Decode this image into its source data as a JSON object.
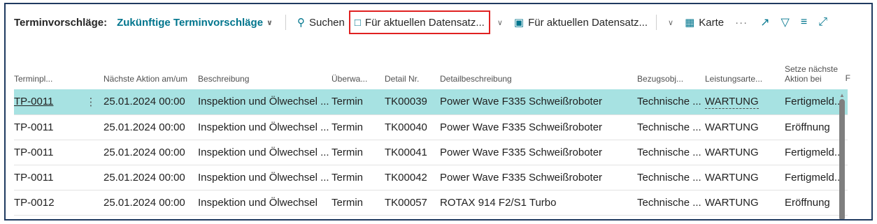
{
  "toolbar": {
    "title": "Terminvorschläge:",
    "view_name": "Zukünftige Terminvorschläge",
    "search_label": "Suchen",
    "action1_label": "Für aktuellen Datensatz...",
    "action2_label": "Für aktuellen Datensatz...",
    "map_label": "Karte",
    "more": "···"
  },
  "table": {
    "headers": [
      "Terminpl...",
      "",
      "Nächste Aktion am/um",
      "Beschreibung",
      "Überwa...",
      "Detail Nr.",
      "Detailbeschreibung",
      "Bezugsobj...",
      "Leistungsarte...",
      "Setze nächste Aktion bei"
    ],
    "clipped_header": "F",
    "rows": [
      [
        "TP-0011",
        "⋮",
        "25.01.2024 00:00",
        "Inspektion und Ölwechsel ...",
        "Termin",
        "TK00039",
        "Power Wave F335 Schweißroboter",
        "Technische ...",
        "WARTUNG",
        "Fertigmeld..."
      ],
      [
        "TP-0011",
        "",
        "25.01.2024 00:00",
        "Inspektion und Ölwechsel ...",
        "Termin",
        "TK00040",
        "Power Wave F335 Schweißroboter",
        "Technische ...",
        "WARTUNG",
        "Eröffnung"
      ],
      [
        "TP-0011",
        "",
        "25.01.2024 00:00",
        "Inspektion und Ölwechsel ...",
        "Termin",
        "TK00041",
        "Power Wave F335 Schweißroboter",
        "Technische ...",
        "WARTUNG",
        "Fertigmeld..."
      ],
      [
        "TP-0011",
        "",
        "25.01.2024 00:00",
        "Inspektion und Ölwechsel ...",
        "Termin",
        "TK00042",
        "Power Wave F335 Schweißroboter",
        "Technische ...",
        "WARTUNG",
        "Fertigmeld..."
      ],
      [
        "TP-0012",
        "",
        "25.01.2024 00:00",
        "Inspektion und Ölwechsel",
        "Termin",
        "TK00057",
        "ROTAX 914 F2/S1 Turbo",
        "Technische ...",
        "WARTUNG",
        "Eröffnung"
      ]
    ],
    "selected_row": 0
  },
  "colors": {
    "accent": "#00758d",
    "selected_row": "#a7e2e2",
    "highlight_border": "#e02121",
    "frame_border": "#1f3a60"
  }
}
